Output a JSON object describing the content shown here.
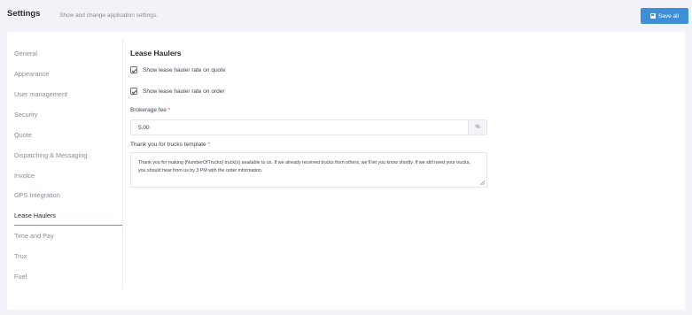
{
  "header": {
    "title": "Settings",
    "subtitle": "Show and change application settings.",
    "save_label": "Save all"
  },
  "sidebar": {
    "items": [
      {
        "label": "General"
      },
      {
        "label": "Appearance"
      },
      {
        "label": "User management"
      },
      {
        "label": "Security"
      },
      {
        "label": "Quote"
      },
      {
        "label": "Dispatching & Messaging"
      },
      {
        "label": "Invoice"
      },
      {
        "label": "GPS Integration"
      },
      {
        "label": "Lease Haulers"
      },
      {
        "label": "Time and Pay"
      },
      {
        "label": "Trux"
      },
      {
        "label": "Fuel"
      }
    ],
    "active_index": 8
  },
  "main": {
    "section_title": "Lease Haulers",
    "checkbox_quote_label": "Show lease hauler rate on quote",
    "checkbox_quote_checked": true,
    "checkbox_order_label": "Show lease hauler rate on order",
    "checkbox_order_checked": true,
    "brokerage_label": "Brokerage fee",
    "brokerage_required": "*",
    "brokerage_value": "5.00",
    "brokerage_suffix": "%",
    "template_label": "Thank you for trucks template",
    "template_required": "*",
    "template_value": "Thank you for making {NumberOfTrucks} truck(s) available to us. If we already received trucks from others, we'll let you know shortly. If we still need your trucks, you should hear from us by 3 PM with the order information."
  },
  "colors": {
    "accent": "#3e8fd6",
    "required": "#e5534b",
    "background": "#f2f3f8"
  }
}
